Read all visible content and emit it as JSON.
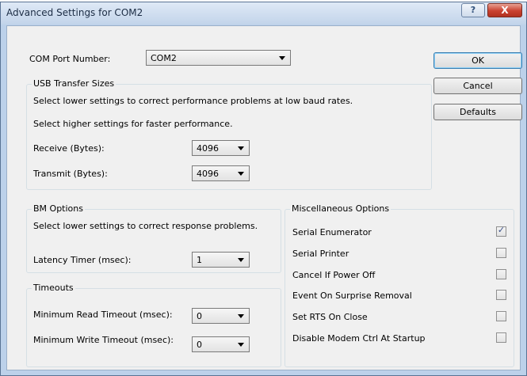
{
  "window": {
    "title": "Advanced Settings for COM2",
    "help_label": "?",
    "close_label": "X"
  },
  "com_port": {
    "label": "COM Port Number:",
    "value": "COM2"
  },
  "buttons": {
    "ok": "OK",
    "cancel": "Cancel",
    "defaults": "Defaults"
  },
  "usb_transfer": {
    "title": "USB Transfer Sizes",
    "hint_lower": "Select lower settings to correct performance problems at low baud rates.",
    "hint_higher": "Select higher settings for faster performance.",
    "receive_label": "Receive (Bytes):",
    "receive_value": "4096",
    "transmit_label": "Transmit (Bytes):",
    "transmit_value": "4096"
  },
  "bm_options": {
    "title": "BM Options",
    "hint": "Select lower settings to correct response problems.",
    "latency_label": "Latency Timer (msec):",
    "latency_value": "1"
  },
  "timeouts": {
    "title": "Timeouts",
    "read_label": "Minimum Read Timeout (msec):",
    "read_value": "0",
    "write_label": "Minimum Write Timeout (msec):",
    "write_value": "0"
  },
  "misc": {
    "title": "Miscellaneous Options",
    "options": [
      {
        "label": "Serial Enumerator",
        "checked": true,
        "mark": "✓"
      },
      {
        "label": "Serial Printer",
        "checked": false,
        "mark": ""
      },
      {
        "label": "Cancel If Power Off",
        "checked": false,
        "mark": ""
      },
      {
        "label": "Event On Surprise Removal",
        "checked": false,
        "mark": ""
      },
      {
        "label": "Set RTS On Close",
        "checked": false,
        "mark": ""
      },
      {
        "label": "Disable Modem Ctrl At Startup",
        "checked": false,
        "mark": ""
      }
    ]
  }
}
